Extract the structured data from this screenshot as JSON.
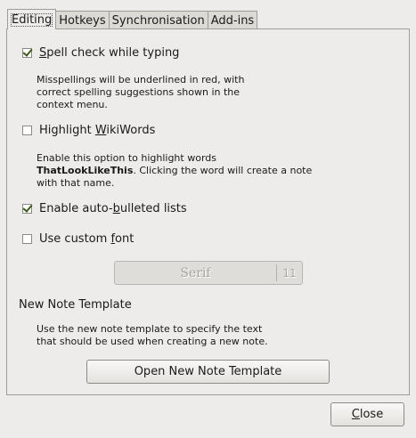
{
  "tabs": [
    {
      "label": "Editing",
      "active": true
    },
    {
      "label": "Hotkeys",
      "active": false
    },
    {
      "label": "Synchronisation",
      "active": false
    },
    {
      "label": "Add-ins",
      "active": false
    }
  ],
  "spell_check": {
    "pre": "",
    "mnemonic": "S",
    "post": "pell check while typing",
    "checked": true,
    "description": [
      "Misspellings will be underlined in red, with",
      "correct spelling suggestions shown in the",
      "context menu."
    ]
  },
  "wikiwords": {
    "pre": "Highlight ",
    "mnemonic": "W",
    "post": "ikiWords",
    "checked": false,
    "description_line1": "Enable this option to highlight words",
    "description_bold": "ThatLookLikeThis",
    "description_line2_rest": ". Clicking the word will create a note",
    "description_line3": "with that name."
  },
  "auto_bullets": {
    "pre": "Enable auto-",
    "mnemonic": "b",
    "post": "ulleted lists",
    "checked": true
  },
  "custom_font": {
    "pre": "Use custom ",
    "mnemonic": "f",
    "post": "ont",
    "checked": false
  },
  "font_button": {
    "name": "Serif",
    "size": "11"
  },
  "template": {
    "title": "New Note Template",
    "description": [
      "Use the new note template to specify the text",
      "that should be used when creating a new note."
    ],
    "button_label": "Open New Note Template"
  },
  "close_button": {
    "mnemonic": "C",
    "post": "lose"
  },
  "colors": {
    "background": "#edeceb",
    "border": "#9d9c9b",
    "check": "#3d5a1a"
  }
}
